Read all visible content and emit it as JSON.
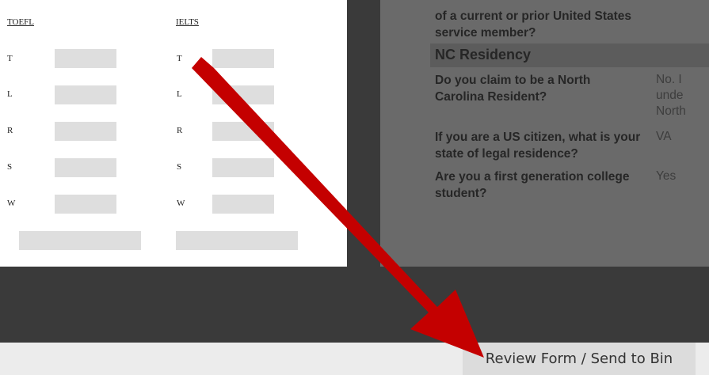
{
  "english_scores": {
    "toefl_label": "TOEFL",
    "ielts_label": "IELTS",
    "rows": [
      {
        "letter": "T"
      },
      {
        "letter": "L"
      },
      {
        "letter": "R"
      },
      {
        "letter": "S"
      },
      {
        "letter": "W"
      }
    ]
  },
  "application": {
    "partial_question": "of a current or prior United States service member?",
    "section_title": "NC Residency",
    "questions": [
      {
        "question": "Do you claim to be a North Carolina Resident?",
        "answer_lines": [
          "No. I",
          "unde",
          "North"
        ]
      },
      {
        "question": "If you are a US citizen, what is your state of legal residence?",
        "answer_lines": [
          "VA"
        ]
      },
      {
        "question": "Are you a first generation college student?",
        "answer_lines": [
          "Yes"
        ]
      }
    ]
  },
  "footer": {
    "review_button": "Review Form / Send to Bin"
  },
  "colors": {
    "arrow": "#c40000",
    "page_background": "#3a3a3a",
    "dimmed_panel": "#6a6a6a"
  },
  "icons": {
    "annotation_arrow": "arrow-icon"
  }
}
